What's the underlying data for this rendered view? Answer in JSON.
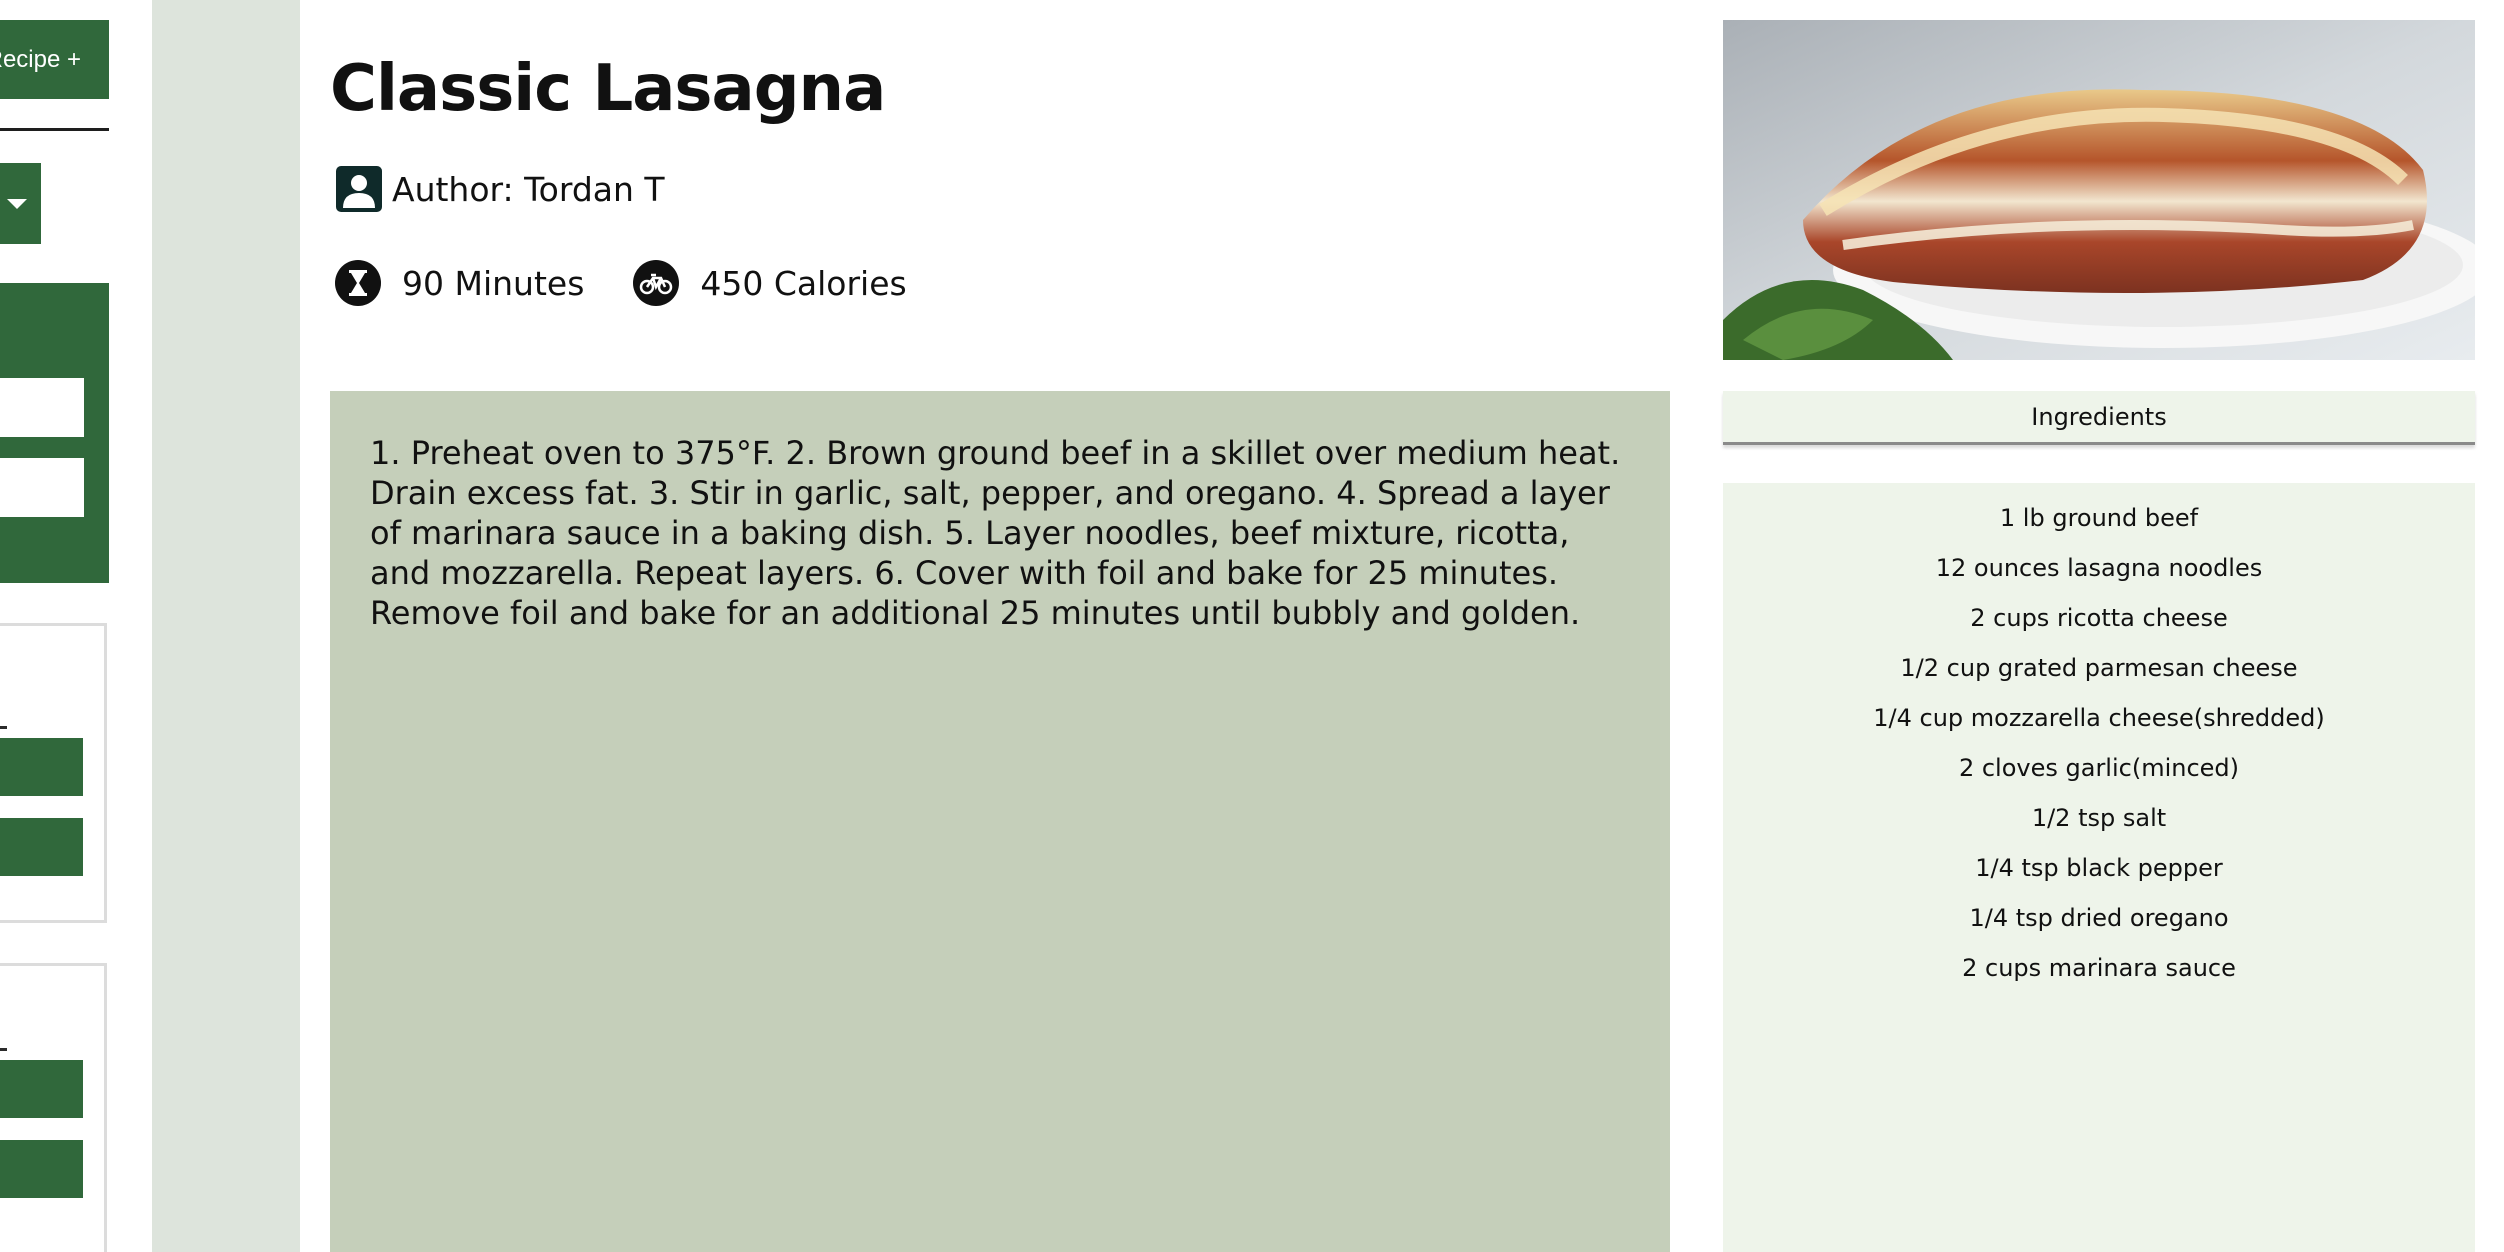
{
  "sidebar": {
    "add_recipe_label": "Recipe +"
  },
  "recipe": {
    "title": "Classic Lasagna",
    "author": "Author: Tordan T",
    "time": "90 Minutes",
    "calories": "450 Calories",
    "instructions": "1. Preheat oven to 375°F. 2. Brown ground beef in a skillet over medium heat. Drain excess fat. 3. Stir in garlic, salt, pepper, and oregano. 4. Spread a layer of marinara sauce in a baking dish. 5. Layer noodles, beef mixture, ricotta, and mozzarella. Repeat layers. 6. Cover with foil and bake for 25 minutes. Remove foil and bake for an additional 25 minutes until bubbly and golden."
  },
  "ingredients": {
    "header": "Ingredients",
    "items": [
      "1 lb ground beef",
      "12 ounces lasagna noodles",
      "2 cups ricotta cheese",
      "1/2 cup grated parmesan cheese",
      "1/4 cup mozzarella cheese(shredded)",
      "2 cloves garlic(minced)",
      "1/2 tsp salt",
      "1/4 tsp black pepper",
      "1/4 tsp dried oregano",
      "2 cups marinara sauce"
    ]
  },
  "icons": {
    "author": "user-icon",
    "time": "hourglass-icon",
    "calories": "bicycle-icon",
    "dropdown": "caret-down-icon"
  },
  "colors": {
    "accent": "#30683b",
    "gutter": "#dde4dc",
    "instructions_bg": "#c5cfba",
    "ingredients_bg": "#eef4ea"
  }
}
